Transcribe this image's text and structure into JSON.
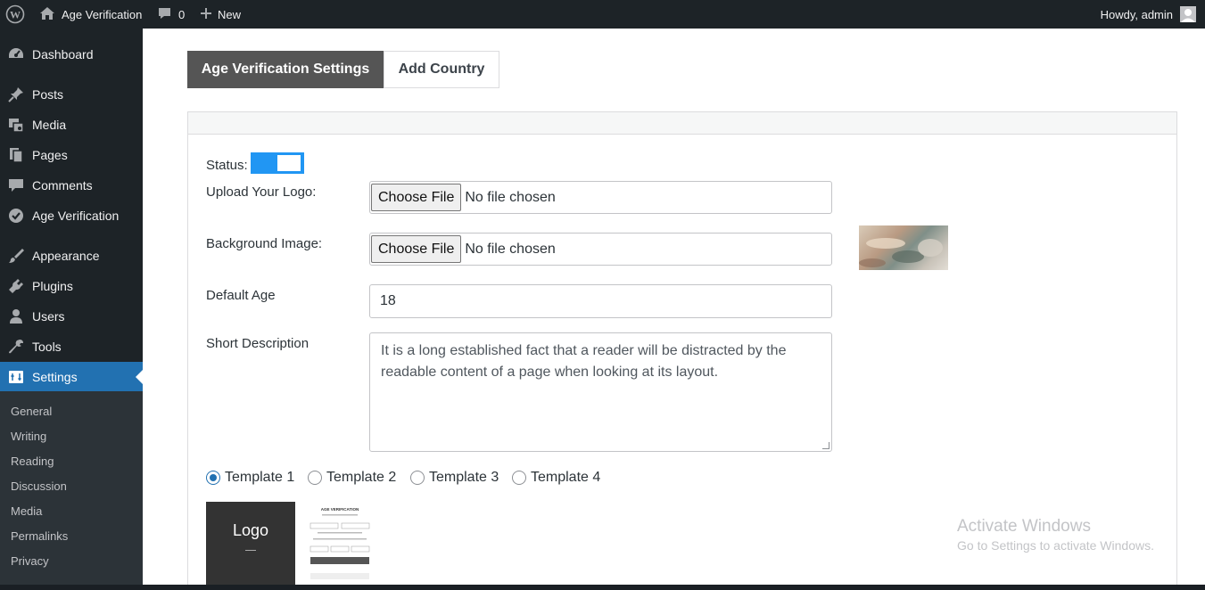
{
  "admin_bar": {
    "site_name": "Age Verification",
    "comments_count": "0",
    "new_label": "New",
    "greeting": "Howdy, admin"
  },
  "sidebar": {
    "items": [
      {
        "label": "Dashboard",
        "icon": "dashboard-icon"
      },
      {
        "label": "Posts",
        "icon": "pin-icon"
      },
      {
        "label": "Media",
        "icon": "media-icon"
      },
      {
        "label": "Pages",
        "icon": "pages-icon"
      },
      {
        "label": "Comments",
        "icon": "comment-icon"
      },
      {
        "label": "Age Verification",
        "icon": "check-circle-icon"
      },
      {
        "label": "Appearance",
        "icon": "brush-icon"
      },
      {
        "label": "Plugins",
        "icon": "plug-icon"
      },
      {
        "label": "Users",
        "icon": "user-icon"
      },
      {
        "label": "Tools",
        "icon": "wrench-icon"
      },
      {
        "label": "Settings",
        "icon": "settings-icon",
        "active": true
      }
    ],
    "submenu": [
      "General",
      "Writing",
      "Reading",
      "Discussion",
      "Media",
      "Permalinks",
      "Privacy"
    ]
  },
  "tabs": {
    "settings": "Age Verification Settings",
    "add_country": "Add Country"
  },
  "form": {
    "status_label": "Status:",
    "status_on": true,
    "logo_label": "Upload Your Logo:",
    "bg_label": "Background Image:",
    "choose_file": "Choose File",
    "no_file": "No file chosen",
    "age_label": "Default Age",
    "age_value": "18",
    "desc_label": "Short Description",
    "desc_value": "It is a long established fact that a reader will be distracted by the readable content of a page when looking at its layout.",
    "templates": [
      "Template 1",
      "Template 2",
      "Template 3",
      "Template 4"
    ],
    "selected_template": "Template 1"
  },
  "preview": {
    "logo_text": "Logo",
    "heading": "AGE VERIFICATION"
  },
  "watermark": {
    "title": "Activate Windows",
    "subtitle": "Go to Settings to activate Windows."
  },
  "colors": {
    "admin_bg": "#1d2327",
    "accent": "#2271b1",
    "toggle": "#2196f3",
    "active_tab": "#555555"
  }
}
